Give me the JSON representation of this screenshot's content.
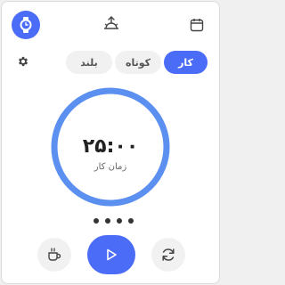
{
  "header": {
    "watch_icon": "watch-icon",
    "center_icon": "sunrise-icon",
    "calendar_icon": "calendar-icon"
  },
  "settings_icon": "gear-icon",
  "tabs": [
    {
      "label": "بلند",
      "active": false
    },
    {
      "label": "کوتاه",
      "active": false
    },
    {
      "label": "کار",
      "active": true
    }
  ],
  "timer": {
    "time": "۲۵:۰۰",
    "label": "زمان کار",
    "progress": 1.0
  },
  "session_dots": 4,
  "controls": {
    "break_icon": "coffee-icon",
    "play_icon": "play-icon",
    "reset_icon": "refresh-icon"
  },
  "colors": {
    "accent": "#4a6cf7",
    "ring": "#5b8ff0"
  }
}
